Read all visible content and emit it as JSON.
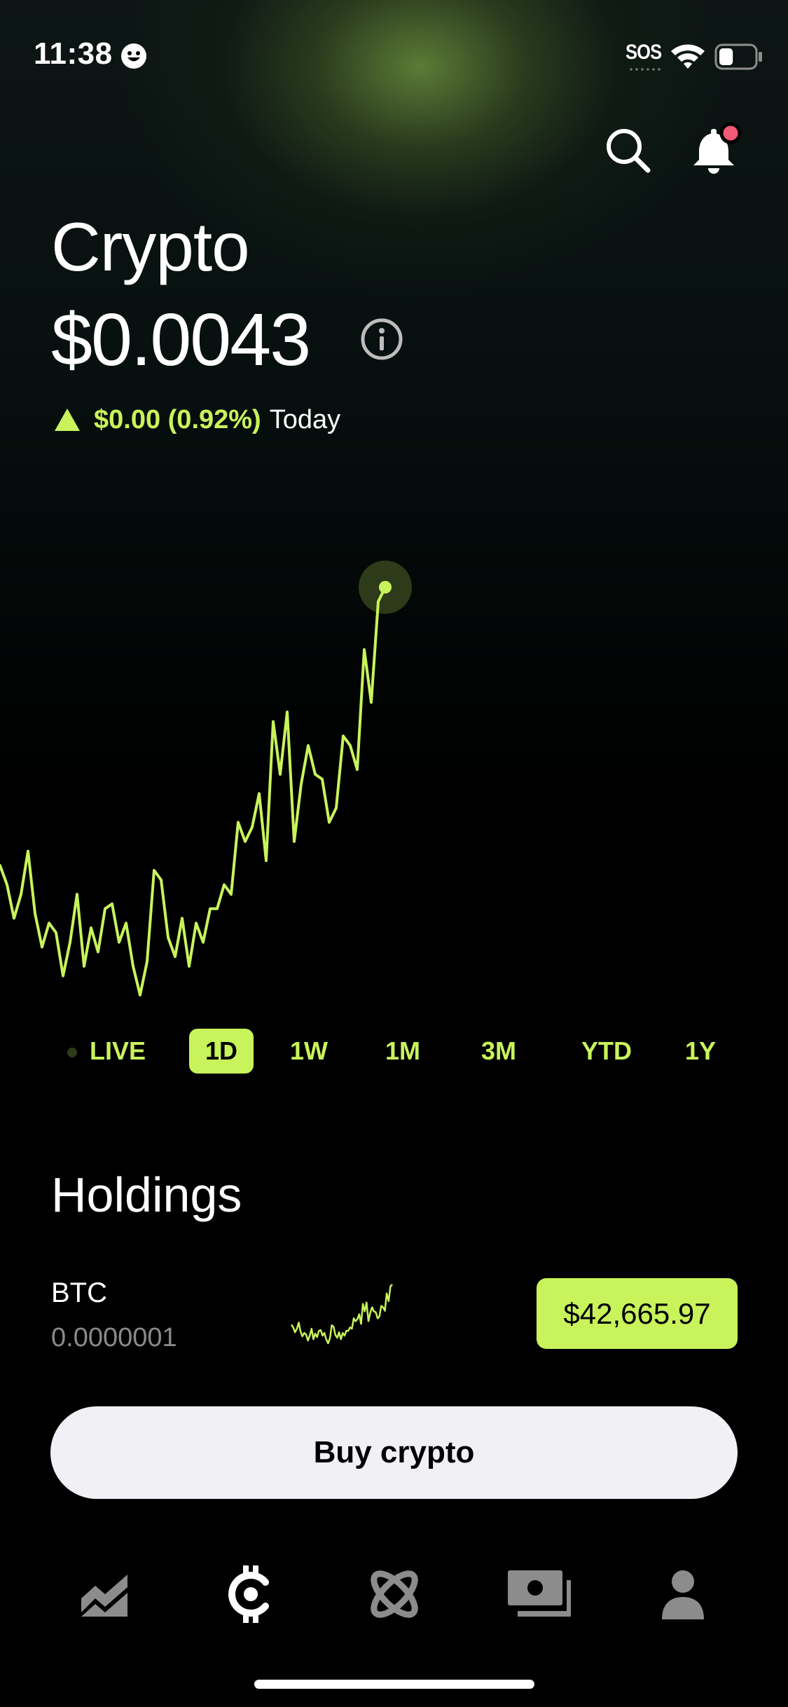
{
  "status_bar": {
    "time": "11:38",
    "carrier": "SOS",
    "battery_level": 0.4
  },
  "header": {
    "title": "Crypto",
    "balance": "$0.0043",
    "change_value": "$0.00 (0.92%)",
    "change_period": "Today",
    "icons": [
      "search-icon",
      "bell-icon",
      "info-icon"
    ],
    "notification_badge_color": "#ef5a74"
  },
  "theme": {
    "accent": "#c8f35b",
    "background": "#000000"
  },
  "chart_data": {
    "type": "line",
    "title": "",
    "xlabel": "",
    "ylabel": "",
    "values": [
      0.00372,
      0.00368,
      0.00361,
      0.00366,
      0.00375,
      0.00362,
      0.00355,
      0.0036,
      0.00358,
      0.00349,
      0.00356,
      0.00366,
      0.00351,
      0.00359,
      0.00354,
      0.00363,
      0.00364,
      0.00356,
      0.0036,
      0.00351,
      0.00345,
      0.00352,
      0.00371,
      0.00369,
      0.00357,
      0.00353,
      0.00361,
      0.00351,
      0.0036,
      0.00356,
      0.00363,
      0.00363,
      0.00368,
      0.00366,
      0.00381,
      0.00377,
      0.0038,
      0.00387,
      0.00373,
      0.00402,
      0.00391,
      0.00404,
      0.00377,
      0.00389,
      0.00397,
      0.00391,
      0.0039,
      0.00381,
      0.00384,
      0.00399,
      0.00397,
      0.00392,
      0.00417,
      0.00406,
      0.00427,
      0.0043
    ]
  },
  "time_ranges": {
    "selected": "1D",
    "items": [
      "LIVE",
      "1D",
      "1W",
      "1M",
      "3M",
      "YTD",
      "1Y"
    ]
  },
  "holdings": {
    "title": "Holdings",
    "items": [
      {
        "symbol": "BTC",
        "quantity": "0.0000001",
        "price": "$42,665.97"
      }
    ]
  },
  "actions": {
    "buy_label": "Buy crypto"
  },
  "nav": {
    "items": [
      {
        "icon": "investing-chart-icon",
        "active": false
      },
      {
        "icon": "crypto-icon",
        "active": true
      },
      {
        "icon": "explore-atom-icon",
        "active": false
      },
      {
        "icon": "cash-card-icon",
        "active": false
      },
      {
        "icon": "profile-icon",
        "active": false
      }
    ]
  }
}
